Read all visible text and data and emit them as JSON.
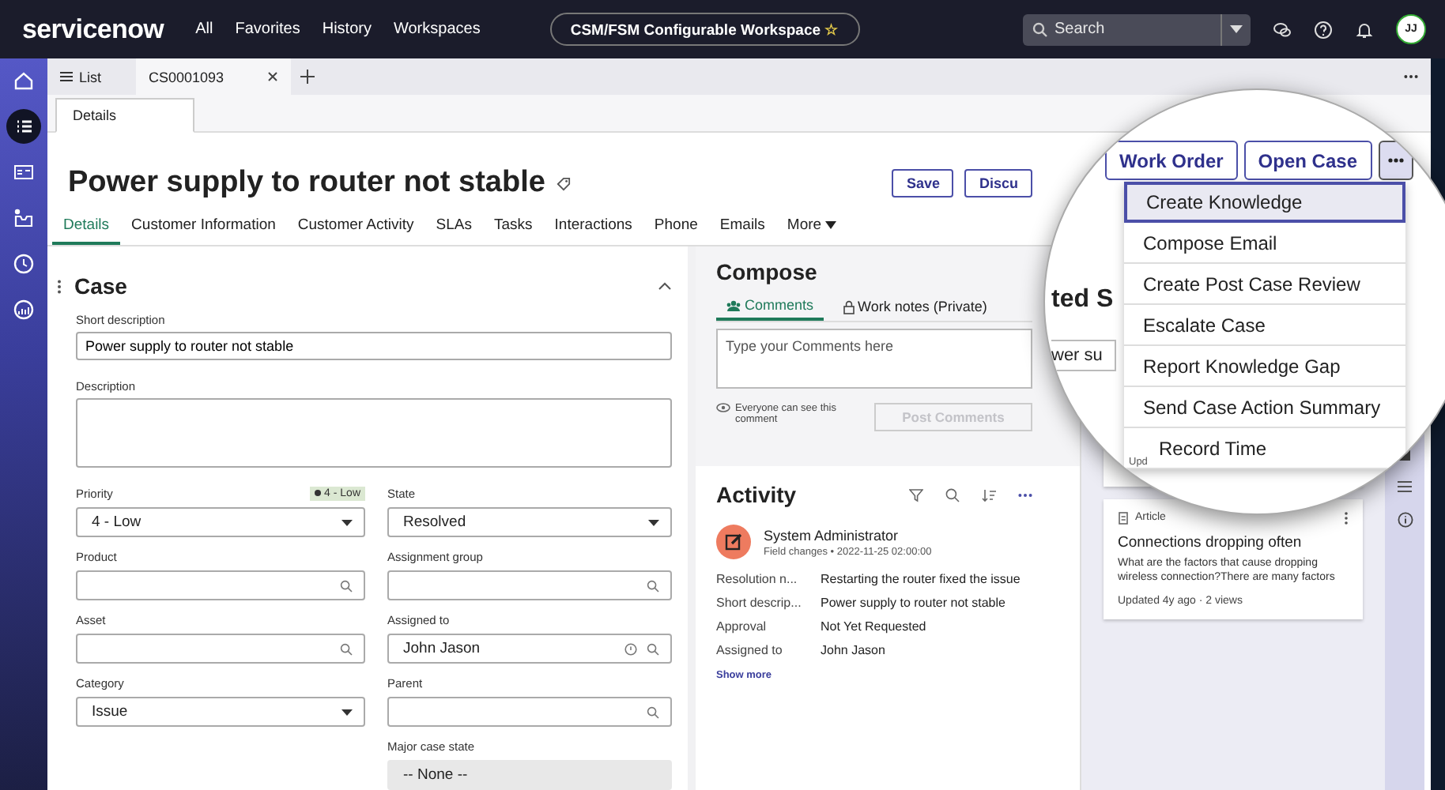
{
  "top_bar": {
    "logo": "servicenow",
    "nav": [
      "All",
      "Favorites",
      "History",
      "Workspaces"
    ],
    "workspace": "CSM/FSM Configurable Workspace",
    "favorite_star": "☆",
    "search": {
      "placeholder": "Search"
    },
    "avatar": "JJ"
  },
  "rail": [
    {
      "kind": "home",
      "selected": false
    },
    {
      "kind": "list",
      "selected": true
    },
    {
      "kind": "card",
      "selected": false
    },
    {
      "kind": "inbox",
      "selected": false
    },
    {
      "kind": "clock",
      "selected": false
    },
    {
      "kind": "chart",
      "selected": false
    }
  ],
  "workspace_tabs": [
    {
      "label": "List",
      "selected": false,
      "closable": false
    },
    {
      "label": "CS0001093",
      "selected": true,
      "closable": true
    }
  ],
  "sub_tabs": [
    {
      "label": "Details",
      "selected": true
    }
  ],
  "record": {
    "title": "Power supply to router not stable",
    "buttons": [
      "Save",
      "Discu"
    ]
  },
  "record_tabs": [
    {
      "label": "Details",
      "selected": true
    },
    {
      "label": "Customer Information",
      "selected": false
    },
    {
      "label": "Customer Activity",
      "selected": false
    },
    {
      "label": "SLAs",
      "selected": false
    },
    {
      "label": "Tasks",
      "selected": false
    },
    {
      "label": "Interactions",
      "selected": false
    },
    {
      "label": "Phone",
      "selected": false
    },
    {
      "label": "Emails",
      "selected": false
    }
  ],
  "more_tab": "More",
  "case_form": {
    "title": "Case",
    "short_description": {
      "label": "Short description",
      "value": "Power supply to router not stable"
    },
    "description": {
      "label": "Description"
    },
    "columns": [
      [
        {
          "kind": "select",
          "label": "Priority",
          "value": "4 - Low",
          "badge": "4 - Low"
        },
        {
          "kind": "lookup",
          "label": "Product"
        },
        {
          "kind": "lookup",
          "label": "Asset"
        },
        {
          "kind": "select",
          "label": "Category",
          "value": "Issue"
        }
      ],
      [
        {
          "kind": "select",
          "label": "State",
          "value": "Resolved"
        },
        {
          "kind": "lookup",
          "label": "Assignment group"
        },
        {
          "kind": "lookup",
          "label": "Assigned to",
          "value": "John Jason",
          "info": true
        },
        {
          "kind": "lookup",
          "label": "Parent"
        },
        {
          "kind": "readonly",
          "label": "Major case state",
          "value": "-- None --"
        }
      ]
    ]
  },
  "compose": {
    "title": "Compose",
    "tabs": [
      {
        "label": "Comments",
        "selected": true
      },
      {
        "label": "Work notes (Private)",
        "selected": false
      }
    ],
    "placeholder": "Type your Comments here",
    "visibility_note": "Everyone can see this comment",
    "post_button": {
      "label": "Post Comments",
      "disabled": true
    }
  },
  "activity": {
    "title": "Activity",
    "author": "System Administrator",
    "meta": "Field changes • 2022-11-25 02:00:00",
    "changes": [
      {
        "field": "Resolution n...",
        "value": "Restarting the router fixed the issue"
      },
      {
        "field": "Short descrip...",
        "value": "Power supply to router not stable"
      },
      {
        "field": "Approval",
        "value": "Not Yet Requested"
      },
      {
        "field": "Assigned to",
        "value": "John Jason"
      }
    ],
    "show_more": "Show more"
  },
  "knowledge": {
    "heading_fragment": "ted S",
    "search_fragment": "wer su",
    "card_fragment": "Upd",
    "article": {
      "type": "Article",
      "title": "Connections dropping often",
      "summary": "What are the factors that cause dropping wireless connection?There are many factors",
      "meta": "Updated 4y ago · 2 views"
    }
  },
  "magnifier": {
    "buttons": [
      "Work Order",
      "Open Case"
    ],
    "more_expanded": true,
    "menu": [
      {
        "label": "Create Knowledge",
        "selected": true
      },
      {
        "label": "Compose Email",
        "selected": false
      },
      {
        "label": "Create Post Case Review",
        "selected": false
      },
      {
        "label": "Escalate Case",
        "selected": false
      },
      {
        "label": "Report Knowledge Gap",
        "selected": false
      },
      {
        "label": "Send Case Action Summary",
        "selected": false
      },
      {
        "label": "Record Time",
        "selected": false
      }
    ]
  }
}
